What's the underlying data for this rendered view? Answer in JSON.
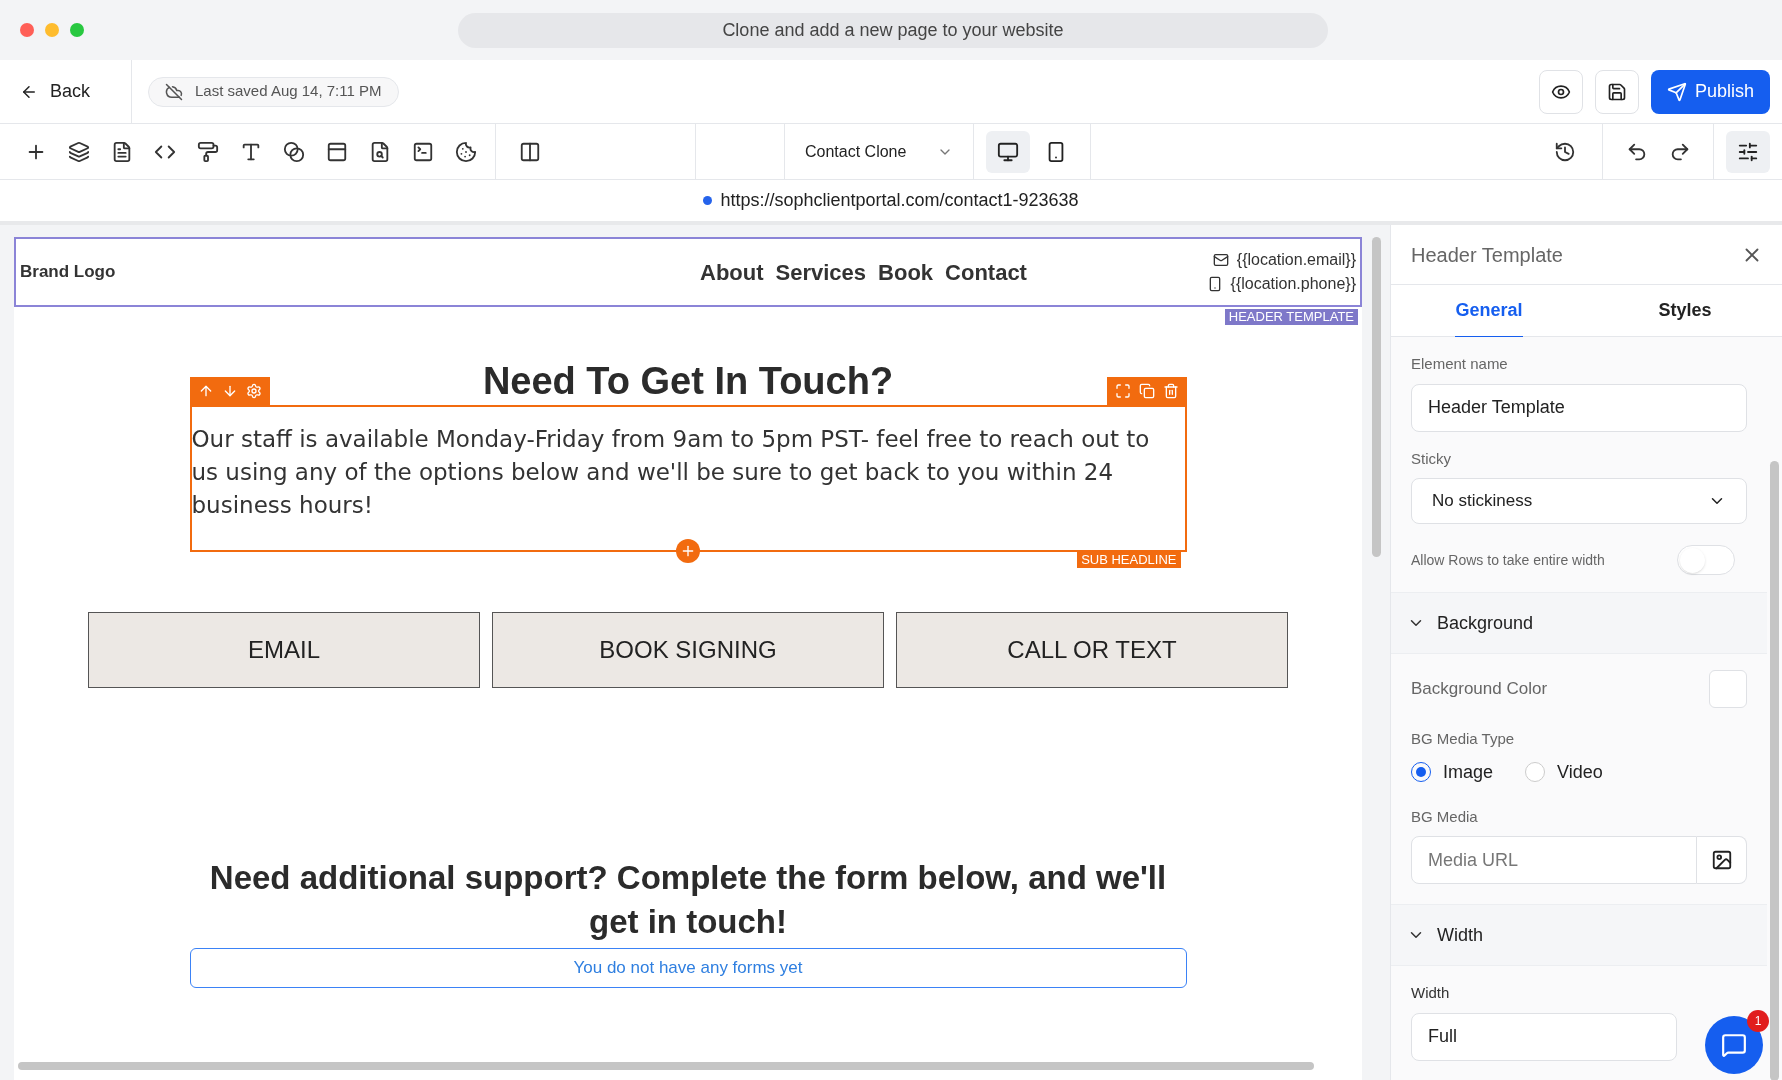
{
  "window": {
    "title": "Clone and add a new page to your website"
  },
  "top_bar": {
    "back": "Back",
    "saved": "Last saved Aug 14, 7:11 PM",
    "publish": "Publish"
  },
  "toolbar": {
    "page_select": "Contact Clone",
    "devices": [
      {
        "kind": "desktop",
        "selected": true
      },
      {
        "kind": "mobile",
        "selected": false
      }
    ]
  },
  "url": "https://sophclientportal.com/contact1-923638",
  "canvas": {
    "header": {
      "logo": "Brand Logo",
      "nav": [
        "About",
        "Services",
        "Book",
        "Contact"
      ],
      "email": "{{location.email}}",
      "phone": "{{location.phone}}",
      "tag": "HEADER TEMPLATE"
    },
    "heading": "Need To Get In Touch?",
    "paragraph": "Our staff is available Monday-Friday from 9am to 5pm PST- feel free to reach out to us using any of the options below and we'll be sure to get back to you within 24 business hours!",
    "paragraph_tag": "SUB HEADLINE",
    "buttons": [
      "EMAIL",
      "BOOK SIGNING",
      "CALL OR TEXT"
    ],
    "support_heading": "Need additional support? Complete the form below, and we'll get in touch!",
    "form_notice": "You do not have any forms yet"
  },
  "panel": {
    "title": "Header Template",
    "tabs": [
      {
        "label": "General",
        "selected": true
      },
      {
        "label": "Styles",
        "selected": false
      }
    ],
    "element_name": {
      "label": "Element name",
      "value": "Header Template"
    },
    "sticky": {
      "label": "Sticky",
      "value": "No stickiness"
    },
    "full_width": {
      "label": "Allow Rows to take entire width",
      "on": false
    },
    "background": {
      "title": "Background",
      "expanded": true,
      "color_label": "Background Color",
      "media_type_label": "BG Media Type",
      "media_types": [
        {
          "label": "Image",
          "selected": true
        },
        {
          "label": "Video",
          "selected": false
        }
      ],
      "media_label": "BG Media",
      "media_placeholder": "Media URL"
    },
    "width": {
      "title": "Width",
      "expanded": true,
      "label": "Width",
      "value": "Full"
    },
    "chat_badge": "1"
  }
}
